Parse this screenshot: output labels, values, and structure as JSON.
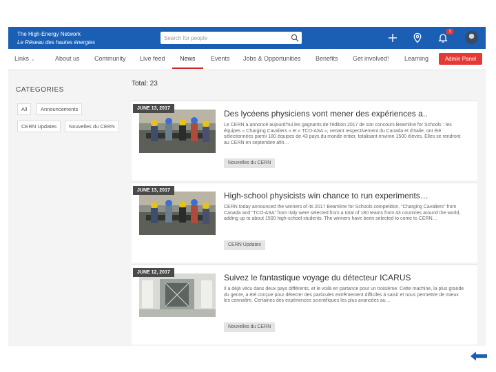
{
  "header": {
    "brand_en": "The High-Energy Network",
    "brand_fr": "Le Réseau des hautes énergies",
    "search_placeholder": "Search for people",
    "notification_count": "1",
    "color": "#1a5fb4"
  },
  "nav": {
    "items": [
      {
        "label": "Links",
        "dropdown": true
      },
      {
        "label": "About us"
      },
      {
        "label": "Community"
      },
      {
        "label": "Live feed"
      },
      {
        "label": "News",
        "active": true
      },
      {
        "label": "Events"
      },
      {
        "label": "Jobs & Opportunities"
      },
      {
        "label": "Benefits"
      },
      {
        "label": "Get involved!"
      },
      {
        "label": "Learning"
      }
    ],
    "admin_label": "Admin Panel",
    "accent_color": "#e53935"
  },
  "sidebar": {
    "title": "CATEGORIES",
    "chips": [
      "All",
      "Announcements",
      "CERN Updates",
      "Nouvelles du CERN"
    ]
  },
  "main": {
    "total_label": "Total: 23",
    "articles": [
      {
        "date": "JUNE 13, 2017",
        "title": "Des lycéens physiciens vont mener des expériences a..",
        "excerpt": "Le CERN a annoncé aujourd'hui les gagnants de l'édition 2017 de son concours Beamline for Schools : les équipes « Charging Cavaliers » et « TCO-ASA », venant respectivement du Canada et d'Italie, ont été sélectionnées parmi 180 équipes de 43 pays du monde entier, totalisant environ 1500 élèves. Elles se rendront au CERN en septembre afin…",
        "tag": "Nouvelles du CERN"
      },
      {
        "date": "JUNE 13, 2017",
        "title": "High-school physicists win chance to run experiments…",
        "excerpt": "CERN today announced the winners of its 2017 Beamline for Schools competition. “Charging Cavaliers” from Canada and “TCO-ASA” from Italy were selected from a total of 180 teams from 43 countries around the world, adding up to about 1500 high-school students. The winners have been selected to come to CERN…",
        "tag": "CERN Updates"
      },
      {
        "date": "JUNE 12, 2017",
        "title": "Suivez le fantastique voyage du détecteur ICARUS",
        "excerpt": "Il a déjà vécu dans deux pays différents, et le voilà en partance pour un troisième. Cette machine, la plus grande du genre, a été conçue pour détecter des particules extrêmement difficiles à saisir et nous permettre de mieux les connaître. Certaines des expériences scientifiques les plus avancées au…",
        "tag": "Nouvelles du CERN"
      }
    ]
  }
}
